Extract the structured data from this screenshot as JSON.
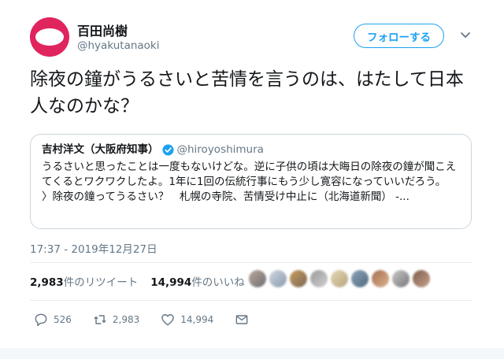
{
  "author": {
    "name": "百田尚樹",
    "handle": "@hyakutanaoki",
    "follow_label": "フォローする"
  },
  "tweet": {
    "text": "除夜の鐘がうるさいと苦情を言うのは、はたして日本人なのかな？",
    "timestamp": "17:37 - 2019年12月27日"
  },
  "quote": {
    "name": "吉村洋文（大阪府知事）",
    "handle": "@hiroyoshimura",
    "text": "うるさいと思ったことは一度もないけどな。逆に子供の頃は大晦日の除夜の鐘が聞こえてくるとワクワクしたよ。1年に1回の伝統行事にもう少し寛容になっていいだろう。",
    "link": "〉除夜の鐘ってうるさい？　札幌の寺院、苦情受け中止に（北海道新聞） -..."
  },
  "stats": {
    "retweets_count": "2,983",
    "retweets_label": "件のリツイート",
    "likes_count": "14,994",
    "likes_label": "件のいいね"
  },
  "actions": {
    "reply_count": "526",
    "retweet_count": "2,983",
    "like_count": "14,994"
  },
  "colors": {
    "accent": "#1da1f2",
    "avatar": "#e0245e",
    "muted": "#657786"
  }
}
